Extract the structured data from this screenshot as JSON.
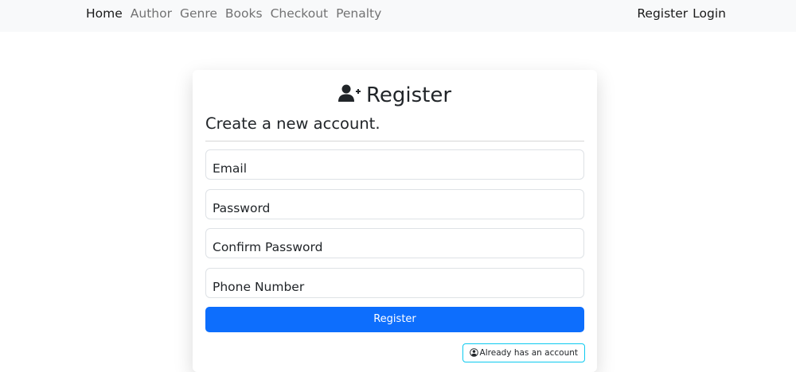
{
  "nav": {
    "links": [
      "Home",
      "Author",
      "Genre",
      "Books",
      "Checkout",
      "Penalty"
    ],
    "right": [
      "Register",
      "Login"
    ]
  },
  "card": {
    "title": "Register",
    "subtitle": "Create a new account.",
    "fields": [
      "Email",
      "Password",
      "Confirm Password",
      "Phone Number"
    ],
    "submit_label": "Register",
    "existing_account_label": "Already has an account"
  },
  "colors": {
    "primary": "#0d6efd",
    "info_border": "#0dcaf0",
    "navbar_bg": "#f8f9fa"
  },
  "icons": {
    "title_icon": "user-plus-icon",
    "existing_account_icon": "user-circle-icon"
  }
}
